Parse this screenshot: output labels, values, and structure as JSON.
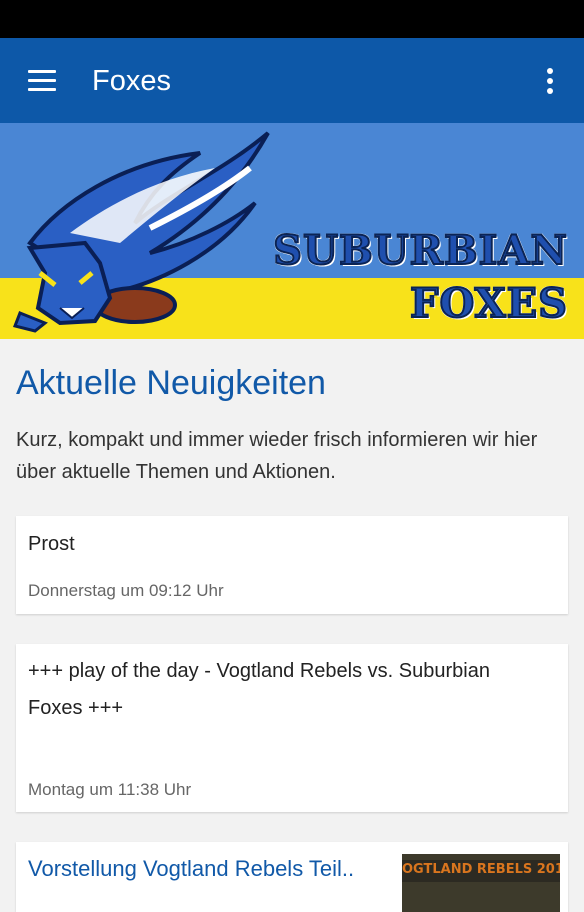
{
  "app_bar": {
    "title": "Foxes",
    "menu_icon": "menu-icon",
    "overflow_icon": "more-vert-icon"
  },
  "banner": {
    "line1": "SUBURBIAN",
    "line2": "FOXES"
  },
  "section": {
    "title": "Aktuelle Neuigkeiten",
    "intro": "Kurz, kompakt und immer wieder frisch informieren wir hier über aktuelle Themen und Aktionen."
  },
  "news": [
    {
      "title": "Prost",
      "date": "Donnerstag um 09:12 Uhr"
    },
    {
      "title": "+++ play of the day - Vogtland Rebels vs. Suburbian Foxes +++",
      "date": "Montag um 11:38 Uhr"
    },
    {
      "title": "Vorstellung Vogtland Rebels Teil..",
      "thumb_text": "OGTLAND REBELS 201"
    }
  ],
  "colors": {
    "primary": "#0d58a8",
    "title_blue": "#1159a8",
    "banner_blue": "#4a86d4",
    "banner_yellow": "#f8e21a"
  }
}
